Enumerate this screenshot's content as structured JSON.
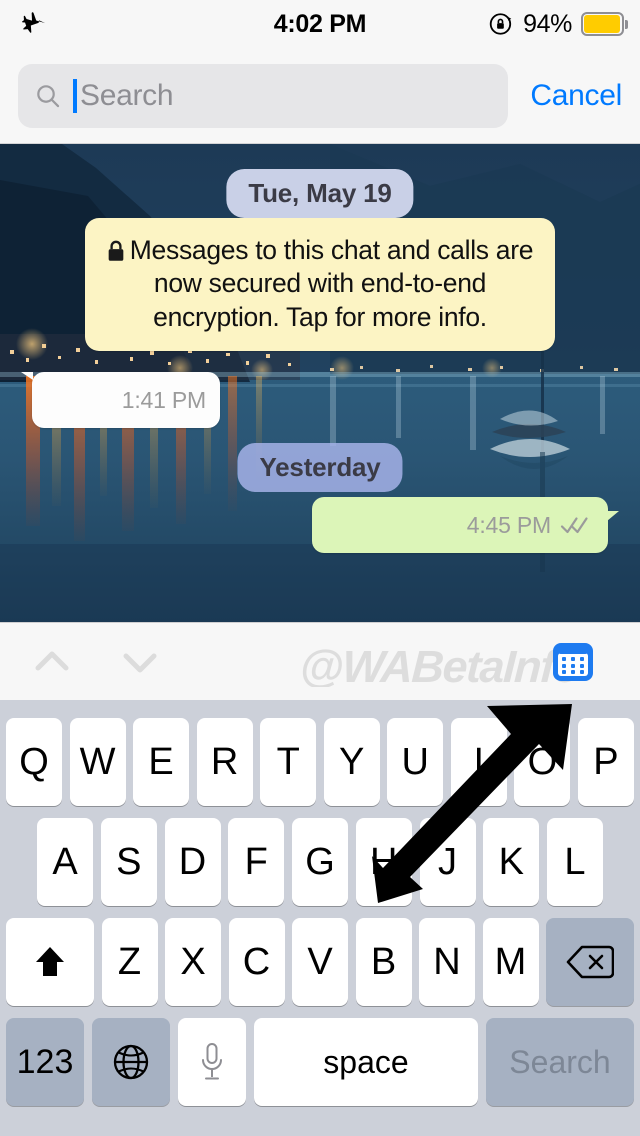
{
  "status_bar": {
    "airplane_icon": "airplane-mode-icon",
    "time": "4:02 PM",
    "rotation_lock_icon": "rotation-lock-icon",
    "battery_percent": "94%",
    "battery_color": "#ffcc00"
  },
  "search": {
    "icon": "search-icon",
    "value": "",
    "placeholder": "Search",
    "cancel_label": "Cancel",
    "cancel_color": "#007aff",
    "caret_color": "#007aff"
  },
  "chat": {
    "date_dividers": [
      {
        "label": "Tue, May 19"
      },
      {
        "label": "Yesterday"
      }
    ],
    "encryption_notice": {
      "icon": "lock-icon",
      "text": "Messages to this chat and calls are now secured with end-to-end encryption. Tap for more info.",
      "background": "#fcf4c4"
    },
    "messages": [
      {
        "direction": "incoming",
        "text": "",
        "timestamp": "1:41 PM",
        "background": "#fdfdfd",
        "status": "none"
      },
      {
        "direction": "outgoing",
        "text": "",
        "timestamp": "4:45 PM",
        "background": "#dcf5b8",
        "status": "delivered",
        "status_icon": "double-check-icon"
      }
    ],
    "watermark": "@WABetaInfo"
  },
  "accessory_bar": {
    "prev_icon": "chevron-up-icon",
    "next_icon": "chevron-down-icon",
    "calendar_button_icon": "calendar-keypad-icon",
    "calendar_button_color": "#1e7bf0",
    "watermark": "@WABetaInfo"
  },
  "keyboard": {
    "row1": [
      "Q",
      "W",
      "E",
      "R",
      "T",
      "Y",
      "U",
      "I",
      "O",
      "P"
    ],
    "row2": [
      "A",
      "S",
      "D",
      "F",
      "G",
      "H",
      "J",
      "K",
      "L"
    ],
    "row3_letters": [
      "Z",
      "X",
      "C",
      "V",
      "B",
      "N",
      "M"
    ],
    "shift_icon": "shift-arrow-icon",
    "backspace_icon": "backspace-delete-icon",
    "numbers_label": "123",
    "globe_icon": "globe-language-icon",
    "mic_icon": "microphone-icon",
    "space_label": "space",
    "return_label": "Search",
    "background": "#ccd0d9"
  },
  "annotation": {
    "arrow_icon": "pointer-arrow-icon",
    "arrow_color": "#000000",
    "points_to": "calendar-keypad-icon"
  }
}
